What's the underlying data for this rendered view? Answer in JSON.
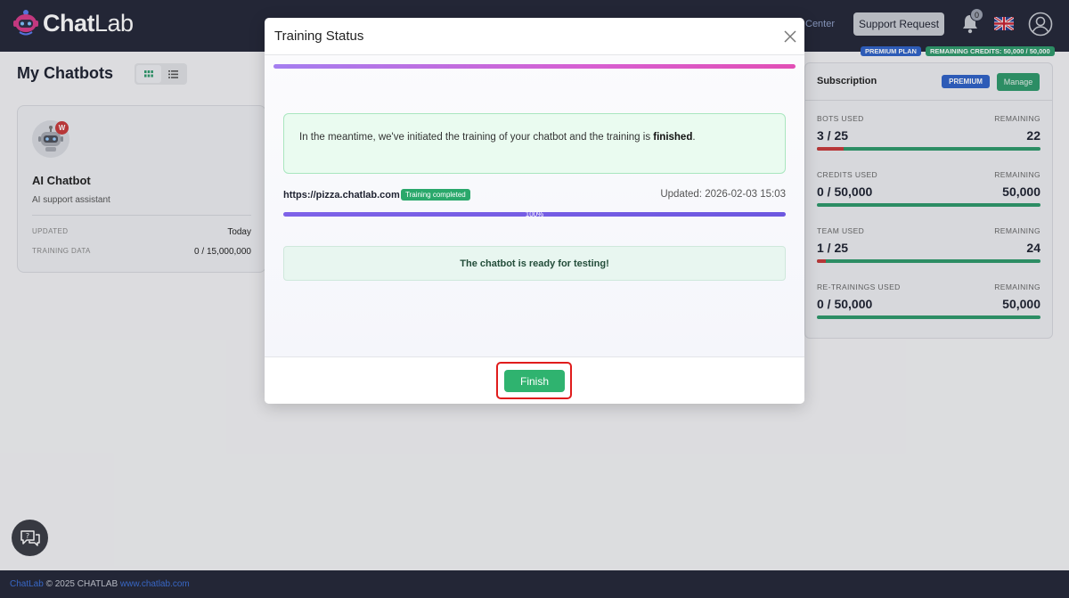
{
  "header": {
    "logo": {
      "brand_main": "Chat",
      "brand_sub": "Lab"
    },
    "help_center_partial": "Center",
    "support_request_label": "Support Request",
    "notifications_count": "0",
    "plan_badge": "PREMIUM PLAN",
    "credits_badge": "REMAINING CREDITS: 50,000 / 50,000"
  },
  "page": {
    "title": "My Chatbots",
    "view_toggle": [
      {
        "icon": "grid-icon",
        "active": true
      },
      {
        "icon": "list-icon",
        "active": false
      }
    ]
  },
  "bot_card": {
    "badge": "W",
    "name": "AI Chatbot",
    "description": "AI support assistant",
    "rows": [
      {
        "label": "UPDATED",
        "value": "Today"
      },
      {
        "label": "TRAINING DATA",
        "value": "0 / 15,000,000"
      }
    ]
  },
  "subscription": {
    "title": "Subscription",
    "plan_badge": "PREMIUM",
    "manage_label": "Manage",
    "stats": [
      {
        "label": "BOTS USED",
        "remaining_label": "REMAINING",
        "used": "3 / 25",
        "remaining": "22",
        "used_fraction": 0.12
      },
      {
        "label": "CREDITS USED",
        "remaining_label": "REMAINING",
        "used": "0 / 50,000",
        "remaining": "50,000",
        "used_fraction": 0
      },
      {
        "label": "TEAM USED",
        "remaining_label": "REMAINING",
        "used": "1 / 25",
        "remaining": "24",
        "used_fraction": 0.04
      },
      {
        "label": "RE-TRAININGS USED",
        "remaining_label": "REMAINING",
        "used": "0 / 50,000",
        "remaining": "50,000",
        "used_fraction": 0
      }
    ]
  },
  "modal": {
    "title": "Training Status",
    "info_text_prefix": "In the meantime, we've initiated the training of your chatbot and the training is ",
    "info_text_bold": "finished",
    "info_text_suffix": ".",
    "url": "https://pizza.chatlab.com",
    "status_badge": "Training completed",
    "updated": "Updated: 2026-02-03 15:03",
    "progress_percent": 100,
    "progress_label": "100%",
    "ready_text": "The chatbot is ready for testing!",
    "finish_label": "Finish"
  },
  "footer": {
    "brand": "ChatLab",
    "copyright": " © 2025 CHATLAB ",
    "website": "www.chatlab.com"
  },
  "colors": {
    "header_bg": "#242838",
    "accent_green": "#2fb36f",
    "premium_blue": "#2f63c8",
    "highlight_red": "#e01c1c"
  }
}
